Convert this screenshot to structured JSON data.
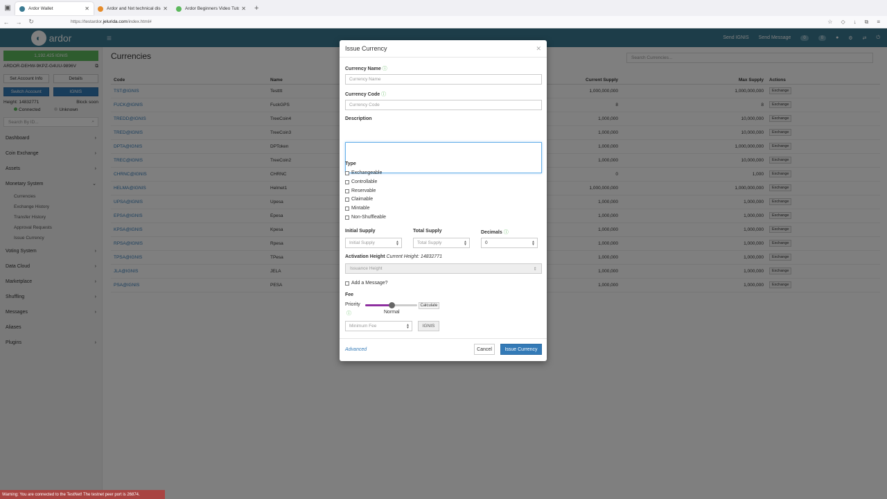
{
  "browser": {
    "tabs": [
      {
        "title": "Ardor Wallet",
        "fav_color": "#3a7a92"
      },
      {
        "title": "Ardor and Nxt technical discus",
        "fav_color": "#e58b2a"
      },
      {
        "title": "Ardor Beginners Video Tutorials",
        "fav_color": "#5cb85c"
      }
    ],
    "url_prefix": "https://testardor.",
    "url_domain": "jelurida.com",
    "url_suffix": "/index.html#"
  },
  "topnav": {
    "logo": "ardor",
    "send_ignis": "Send IGNIS",
    "send_message": "Send Message",
    "badge1": "0",
    "badge2": "0"
  },
  "sidebar": {
    "balance": "1,192.425 IGNIS",
    "account_id": "ARDOR-DEHW-9KPZ-G4UU-9896V",
    "set_account_info": "Set Account Info",
    "details": "Details",
    "switch_account": "Switch Account",
    "chain": "IGNIS",
    "height_label": "Height: 14832771",
    "block_soon": "Block soon",
    "connected": "Connected",
    "unknown": "Unknown",
    "search_placeholder": "Search By ID...",
    "menu": [
      {
        "label": "Dashboard"
      },
      {
        "label": "Coin Exchange"
      },
      {
        "label": "Assets"
      },
      {
        "label": "Monetary System"
      }
    ],
    "submenu": [
      "Currencies",
      "Exchange History",
      "Transfer History",
      "Approval Requests",
      "Issue Currency"
    ],
    "menu2": [
      "Voting System",
      "Data Cloud",
      "Marketplace",
      "Shuffling",
      "Messages",
      "Aliases",
      "Plugins"
    ]
  },
  "content": {
    "title": "Currencies",
    "search_placeholder": "Search Currencies...",
    "headers": {
      "code": "Code",
      "name": "Name",
      "current": "Current Supply",
      "max": "Max Supply",
      "actions": "Actions"
    },
    "exchange_label": "Exchange",
    "rows": [
      {
        "code": "TST@IGNIS",
        "name": "Testttt",
        "current": "1,000,000,000",
        "max": "1,000,000,000"
      },
      {
        "code": "FUCK@IGNIS",
        "name": "FuckGPS",
        "current": "8",
        "max": "8"
      },
      {
        "code": "TREDD@IGNIS",
        "name": "TreeCoin4",
        "current": "1,000,000",
        "max": "10,000,000"
      },
      {
        "code": "TRED@IGNIS",
        "name": "TreeCoin3",
        "current": "1,000,000",
        "max": "10,000,000"
      },
      {
        "code": "DPTA@IGNIS",
        "name": "DPToken",
        "current": "1,000,000",
        "max": "1,000,000,000"
      },
      {
        "code": "TREC@IGNIS",
        "name": "TreeCoin2",
        "current": "1,000,000",
        "max": "10,000,000"
      },
      {
        "code": "CHRNC@IGNIS",
        "name": "CHRNC",
        "current": "0",
        "max": "1,000"
      },
      {
        "code": "HELMA@IGNIS",
        "name": "Helmet1",
        "current": "1,000,000,000",
        "max": "1,000,000,000"
      },
      {
        "code": "UPSA@IGNIS",
        "name": "Upesa",
        "current": "1,000,000",
        "max": "1,000,000"
      },
      {
        "code": "EPSA@IGNIS",
        "name": "Epesa",
        "current": "1,000,000",
        "max": "1,000,000"
      },
      {
        "code": "KPSA@IGNIS",
        "name": "Kpesa",
        "current": "1,000,000",
        "max": "1,000,000"
      },
      {
        "code": "RPSA@IGNIS",
        "name": "Rpesa",
        "current": "1,000,000",
        "max": "1,000,000"
      },
      {
        "code": "TPSA@IGNIS",
        "name": "TPesa",
        "current": "1,000,000",
        "max": "1,000,000"
      },
      {
        "code": "JLA@IGNIS",
        "name": "JELA",
        "current": "1,000,000",
        "max": "1,000,000"
      },
      {
        "code": "PSA@IGNIS",
        "name": "PESA",
        "current": "1,000,000",
        "max": "1,000,000"
      }
    ]
  },
  "modal": {
    "title": "Issue Currency",
    "name_label": "Currency Name",
    "name_placeholder": "Currency Name",
    "code_label": "Currency Code",
    "code_placeholder": "Currency Code",
    "description_label": "Description",
    "type_label": "Type",
    "types": [
      "Exchangeable",
      "Controllable",
      "Reservable",
      "Claimable",
      "Mintable",
      "Non-Shuffleable"
    ],
    "initial_supply_label": "Initial Supply",
    "initial_supply_placeholder": "Initial Supply",
    "total_supply_label": "Total Supply",
    "total_supply_placeholder": "Total Supply",
    "decimals_label": "Decimals",
    "decimals_value": "0",
    "activation_label": "Activation Height",
    "current_height": "Current Height: 14832771",
    "issuance_placeholder": "Issuance Height",
    "add_message": "Add a Message?",
    "fee_label": "Fee",
    "priority_label": "Priority",
    "priority_value": "Normal",
    "priority_level": 0.5,
    "calculate": "Calculate",
    "min_fee_placeholder": "Minimum Fee",
    "fee_unit": "IGNIS",
    "advanced": "Advanced",
    "cancel": "Cancel",
    "submit": "Issue Currency"
  },
  "warning": "Warning: You are connected to the TestNet! The testnet peer port is 26874."
}
